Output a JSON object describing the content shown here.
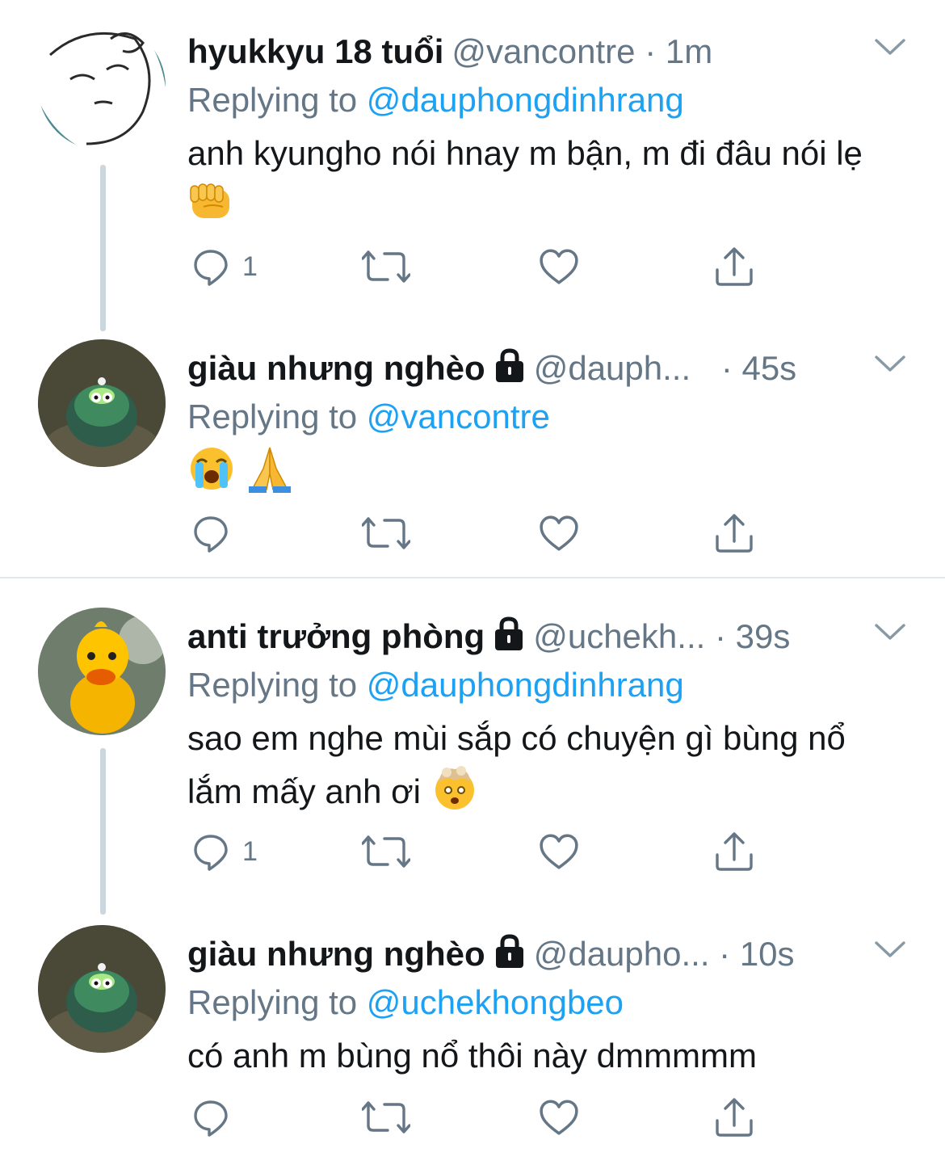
{
  "tweets": [
    {
      "name": "hyukkyu 18 tuổi",
      "handle": "@vancontre",
      "time": "· 1m",
      "replying_prefix": "Replying to",
      "replying_to": "@dauphongdinhrang",
      "text": "anh kyungho nói hnay m bận, m đi đâu nói lẹ",
      "reply_count": "1",
      "locked": false
    },
    {
      "name": "giàu nhưng nghèo",
      "handle": "@dauph...",
      "time": "· 45s",
      "replying_prefix": "Replying to",
      "replying_to": "@vancontre",
      "text": "",
      "reply_count": "",
      "locked": true
    },
    {
      "name": "anti trưởng phòng",
      "handle": "@uchekh...",
      "time": "· 39s",
      "replying_prefix": "Replying to",
      "replying_to": "@dauphongdinhrang",
      "text": "sao em nghe mùi sắp có chuyện gì bùng nổ lắm mấy anh ơi",
      "reply_count": "1",
      "locked": true
    },
    {
      "name": "giàu nhưng nghèo",
      "handle": "@daupho...",
      "time": "· 10s",
      "replying_prefix": "Replying to",
      "replying_to": "@uchekhongbeo",
      "text": "có anh m bùng nổ thôi này dmmmmm",
      "reply_count": "",
      "locked": true
    }
  ],
  "colors": {
    "text": "#14171a",
    "secondary": "#657786",
    "link": "#1da1f2",
    "divider": "#e1e8ed",
    "thread": "#ccd6dd"
  }
}
